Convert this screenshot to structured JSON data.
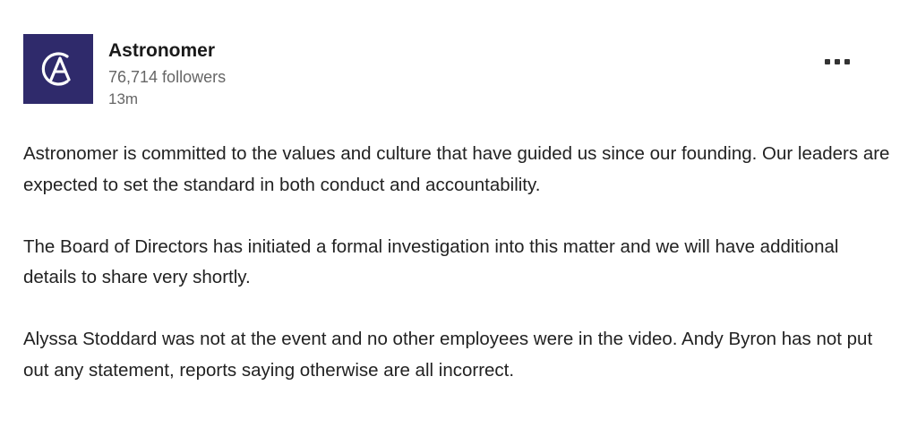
{
  "author": {
    "name": "Astronomer",
    "followers": "76,714 followers",
    "time": "13m",
    "logo_icon": "astronomer-logo",
    "logo_color": "#2f2a6b"
  },
  "menu": {
    "icon": "more-horizontal-icon"
  },
  "post": {
    "paragraphs": [
      "Astronomer is committed to the values and culture that have guided us since our founding. Our leaders are expected to set the standard in both conduct and accountability.",
      "The Board of Directors has initiated a formal investigation into this matter and we will have additional details to share very shortly.",
      "Alyssa Stoddard was not at the event and no other employees were in the video. Andy Byron has not put out any statement, reports saying otherwise are all incorrect."
    ]
  }
}
